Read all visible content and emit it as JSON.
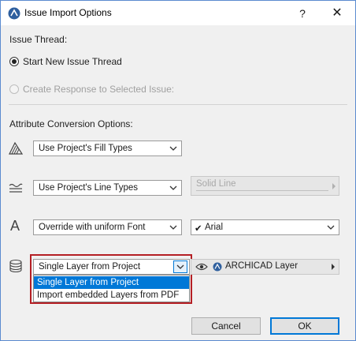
{
  "window": {
    "title": "Issue Import Options",
    "help_glyph": "?",
    "close_glyph": "✕"
  },
  "issue_thread": {
    "heading": "Issue Thread:",
    "options": [
      {
        "label": "Start New Issue Thread",
        "checked": true,
        "enabled": true
      },
      {
        "label": "Create Response to Selected Issue:",
        "checked": false,
        "enabled": false
      }
    ]
  },
  "attribute_conversion": {
    "heading": "Attribute Conversion Options:",
    "fill_types": {
      "icon": "fill-pattern-icon",
      "value": "Use Project's Fill Types"
    },
    "line_types": {
      "icon": "line-type-icon",
      "value": "Use Project's Line Types",
      "secondary_value": "Solid Line"
    },
    "font": {
      "icon": "font-icon",
      "icon_glyph": "A",
      "value": "Override with uniform Font",
      "font_value": "Arial",
      "font_check": "✔"
    },
    "layers": {
      "icon": "layers-icon",
      "value": "Single Layer from Project",
      "layer_value": "ARCHICAD Layer",
      "dropdown_options": [
        "Single Layer from Project",
        "Import embedded Layers from PDF"
      ],
      "selected_index": 0
    }
  },
  "footer": {
    "cancel_label": "Cancel",
    "ok_label": "OK"
  },
  "colors": {
    "accent": "#0078d7",
    "highlight_border": "#b51f24",
    "dialog_bg": "#f0f0f0"
  }
}
